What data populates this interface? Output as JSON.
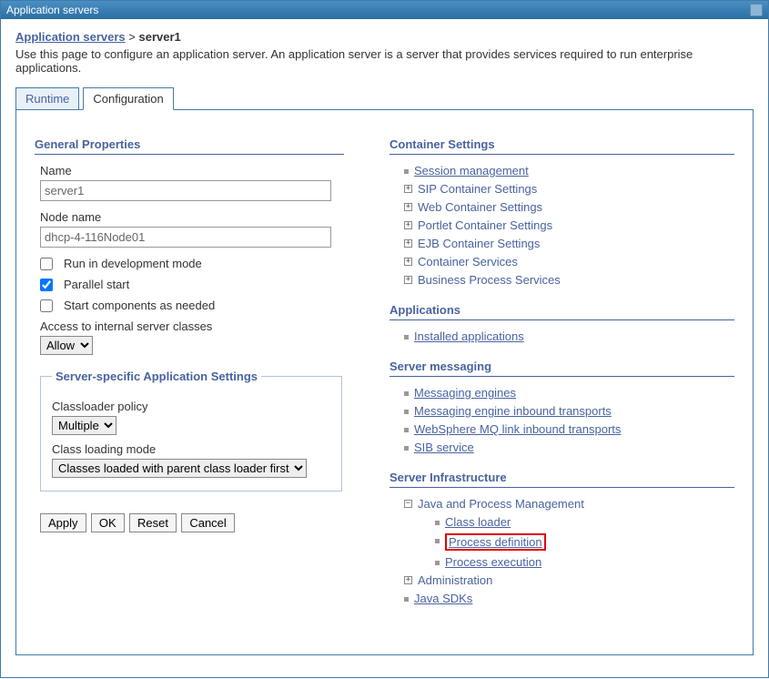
{
  "titlebar": {
    "title": "Application servers"
  },
  "breadcrumb": {
    "link": "Application servers",
    "sep": ">",
    "current": "server1"
  },
  "page_description": "Use this page to configure an application server. An application server is a server that provides services required to run enterprise applications.",
  "tabs": {
    "runtime": "Runtime",
    "configuration": "Configuration"
  },
  "general": {
    "header": "General Properties",
    "name_label": "Name",
    "name_value": "server1",
    "node_label": "Node name",
    "node_value": "dhcp-4-116Node01",
    "run_dev": "Run in development mode",
    "parallel": "Parallel start",
    "start_components": "Start components as needed",
    "access_label": "Access to internal server classes",
    "access_value": "Allow"
  },
  "server_specific": {
    "legend": "Server-specific Application Settings",
    "classloader_label": "Classloader policy",
    "classloader_value": "Multiple",
    "classmode_label": "Class loading mode",
    "classmode_value": "Classes loaded with parent class loader first"
  },
  "buttons": {
    "apply": "Apply",
    "ok": "OK",
    "reset": "Reset",
    "cancel": "Cancel"
  },
  "container": {
    "header": "Container Settings",
    "session": "Session management",
    "sip": "SIP Container Settings",
    "web": "Web Container Settings",
    "portlet": "Portlet Container Settings",
    "ejb": "EJB Container Settings",
    "services": "Container Services",
    "bps": "Business Process Services"
  },
  "applications": {
    "header": "Applications",
    "installed": "Installed applications"
  },
  "messaging": {
    "header": "Server messaging",
    "engines": "Messaging engines",
    "inbound": "Messaging engine inbound transports",
    "mq": "WebSphere MQ link inbound transports",
    "sib": "SIB service"
  },
  "infra": {
    "header": "Server Infrastructure",
    "java_proc": "Java and Process Management",
    "class_loader": "Class loader",
    "proc_def": "Process definition",
    "proc_exec": "Process execution",
    "admin": "Administration",
    "sdks": "Java SDKs"
  }
}
